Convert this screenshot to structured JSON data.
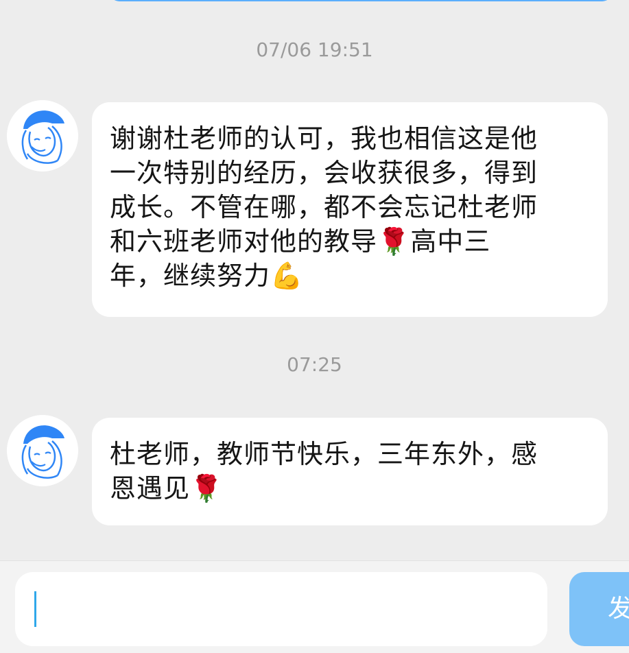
{
  "messages": [
    {
      "timestamp": "07/06 19:51",
      "text": "谢谢杜老师的认可，我也相信这是他\n一次特别的经历，会收获很多，得到\n成长。不管在哪，都不会忘记杜老师\n和六班老师对他的教导🌹高中三\n年，继续努力💪"
    },
    {
      "timestamp": "07:25",
      "text": "杜老师，教师节快乐，三年东外，感\n恩遇见🌹"
    }
  ],
  "composer": {
    "input_value": "",
    "send_label": "发"
  },
  "colors": {
    "background": "#ededed",
    "bubble": "#ffffff",
    "accent": "#2f86f6",
    "send_button": "#7ec2f8"
  },
  "icons": {
    "avatar": "girl-with-cap-avatar-icon"
  }
}
